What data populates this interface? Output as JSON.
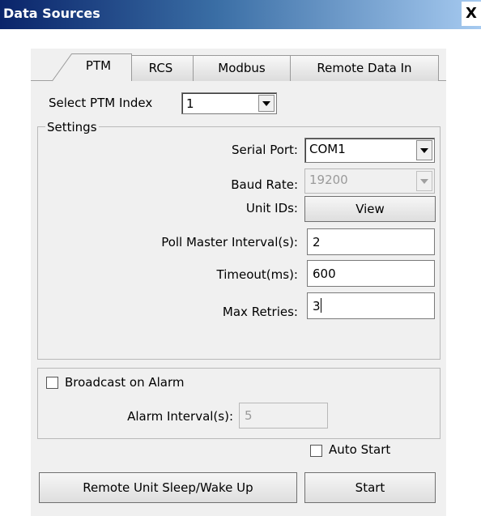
{
  "window": {
    "title": "Data Sources",
    "close_label": "X"
  },
  "tabs": [
    {
      "label": "PTM",
      "active": true
    },
    {
      "label": "RCS",
      "active": false
    },
    {
      "label": "Modbus",
      "active": false
    },
    {
      "label": "Remote Data In",
      "active": false
    }
  ],
  "ptm_index": {
    "label": "Select PTM Index",
    "value": "1"
  },
  "settings": {
    "group_label": "Settings",
    "serial_port": {
      "label": "Serial Port:",
      "value": "COM1"
    },
    "baud_rate": {
      "label": "Baud Rate:",
      "value": "19200",
      "enabled": false
    },
    "unit_ids": {
      "label": "Unit IDs:",
      "button_label": "View"
    },
    "poll_master_interval": {
      "label": "Poll Master Interval(s):",
      "value": "2"
    },
    "timeout": {
      "label": "Timeout(ms):",
      "value": "600"
    },
    "max_retries": {
      "label": "Max Retries:",
      "value": "3"
    }
  },
  "broadcast": {
    "checkbox_label": "Broadcast on Alarm",
    "checked": false,
    "alarm_interval": {
      "label": "Alarm Interval(s):",
      "value": "5",
      "enabled": false
    }
  },
  "auto_start": {
    "label": "Auto Start",
    "checked": false
  },
  "buttons": {
    "sleep_wake": "Remote Unit Sleep/Wake Up",
    "start": "Start"
  },
  "icons": {
    "close": "close-icon",
    "dropdown": "chevron-down-icon"
  }
}
